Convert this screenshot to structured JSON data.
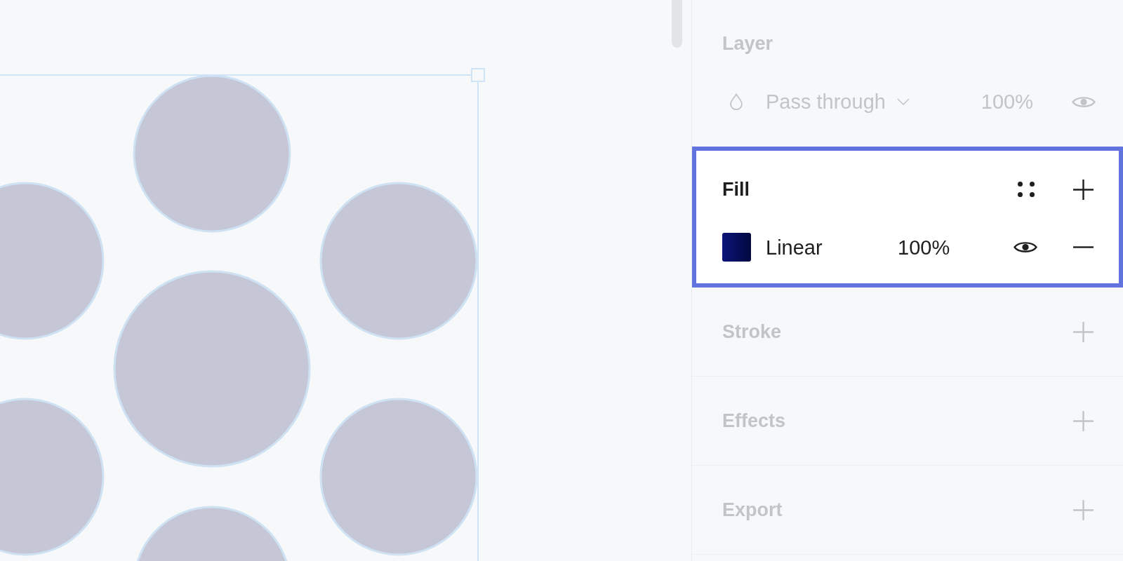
{
  "canvas": {
    "frame_selected": true
  },
  "panel": {
    "sections": [
      {
        "kind": "layer",
        "title": "Layer",
        "dimmed": true,
        "highlighted": false,
        "blend_mode": "Pass through",
        "opacity": "100%",
        "visible": true
      },
      {
        "kind": "fill",
        "title": "Fill",
        "dimmed": false,
        "highlighted": true,
        "fills": [
          {
            "type": "Linear",
            "opacity": "100%",
            "visible": true
          }
        ]
      },
      {
        "kind": "collapsed",
        "title": "Stroke",
        "dimmed": true,
        "highlighted": false
      },
      {
        "kind": "collapsed",
        "title": "Effects",
        "dimmed": true,
        "highlighted": false
      },
      {
        "kind": "collapsed",
        "title": "Export",
        "dimmed": true,
        "highlighted": false
      }
    ]
  }
}
